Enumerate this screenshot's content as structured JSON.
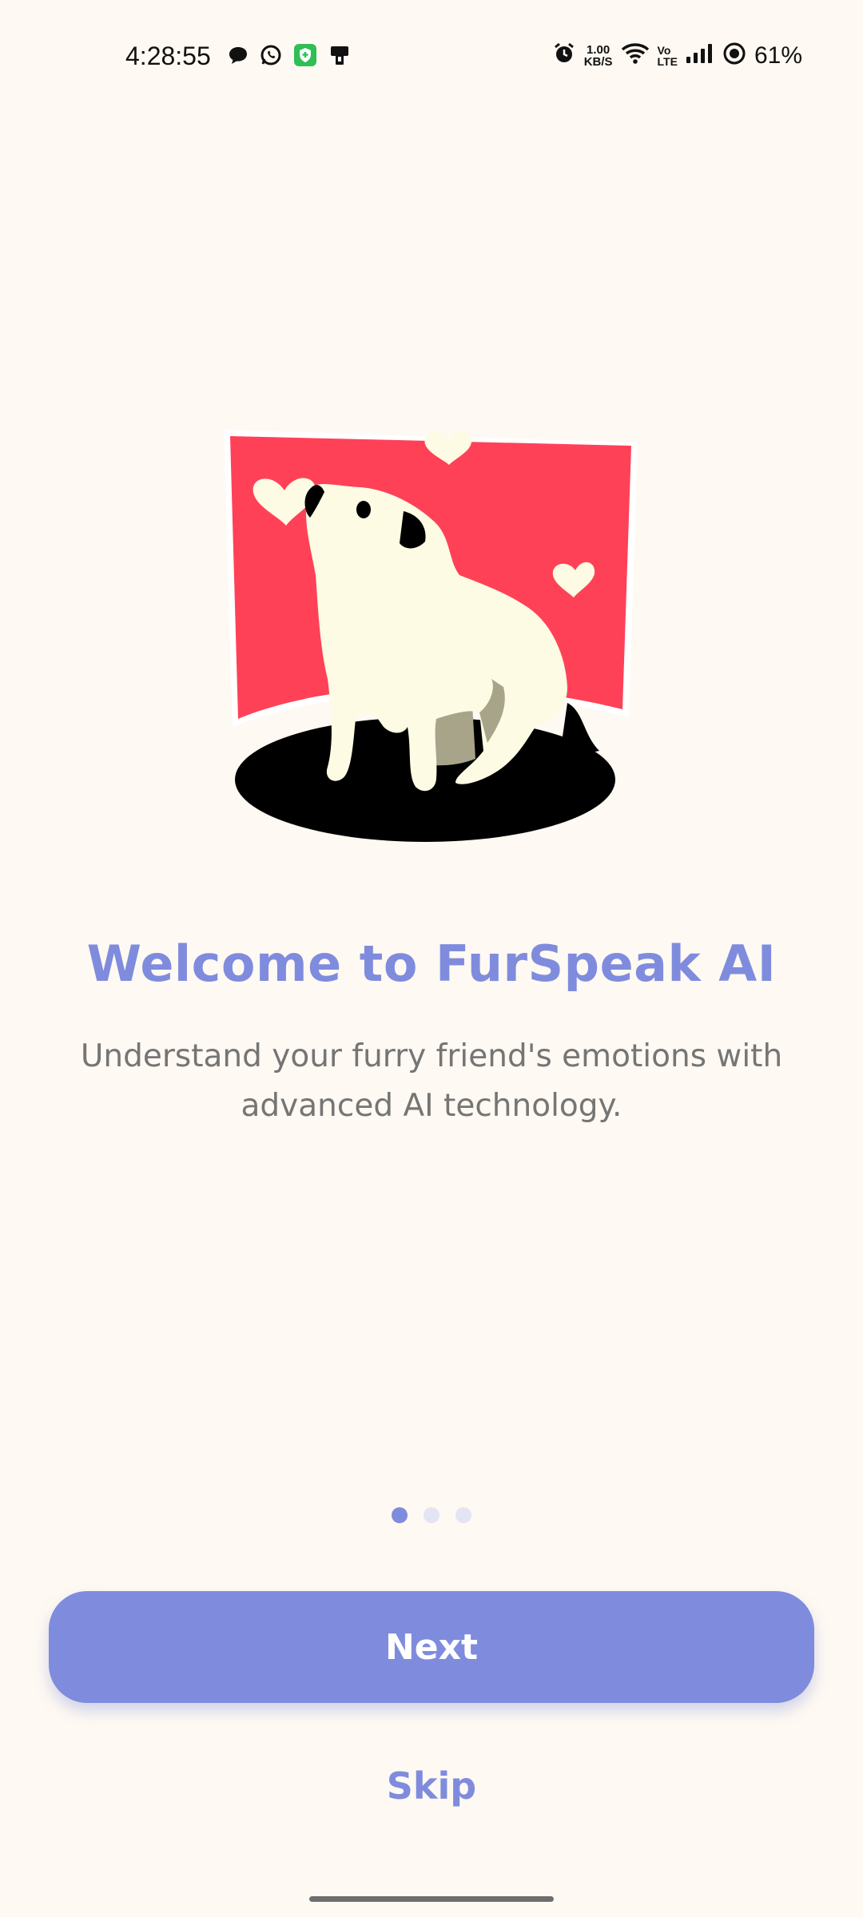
{
  "status_bar": {
    "time": "4:28:55",
    "net_speed_value": "1.00",
    "net_speed_unit": "KB/S",
    "volte_top": "Vo",
    "volte_bottom": "LTE",
    "battery": "61%",
    "left_icons": [
      "chat-bubble-icon",
      "whatsapp-icon",
      "shield-app-icon",
      "device-icon"
    ],
    "right_icons": [
      "alarm-icon",
      "wifi-icon",
      "signal-icon",
      "battery-icon"
    ]
  },
  "onboarding": {
    "title": "Welcome to FurSpeak AI",
    "subtitle": "Understand your furry friend's emotions with advanced AI technology.",
    "page_indicator": {
      "total": 3,
      "active": 1
    },
    "next_label": "Next",
    "skip_label": "Skip"
  },
  "colors": {
    "accent": "#7F8CDD",
    "background": "#FEF9F2",
    "illustration_red": "#FF4157",
    "dog": "#FDFBE3"
  }
}
